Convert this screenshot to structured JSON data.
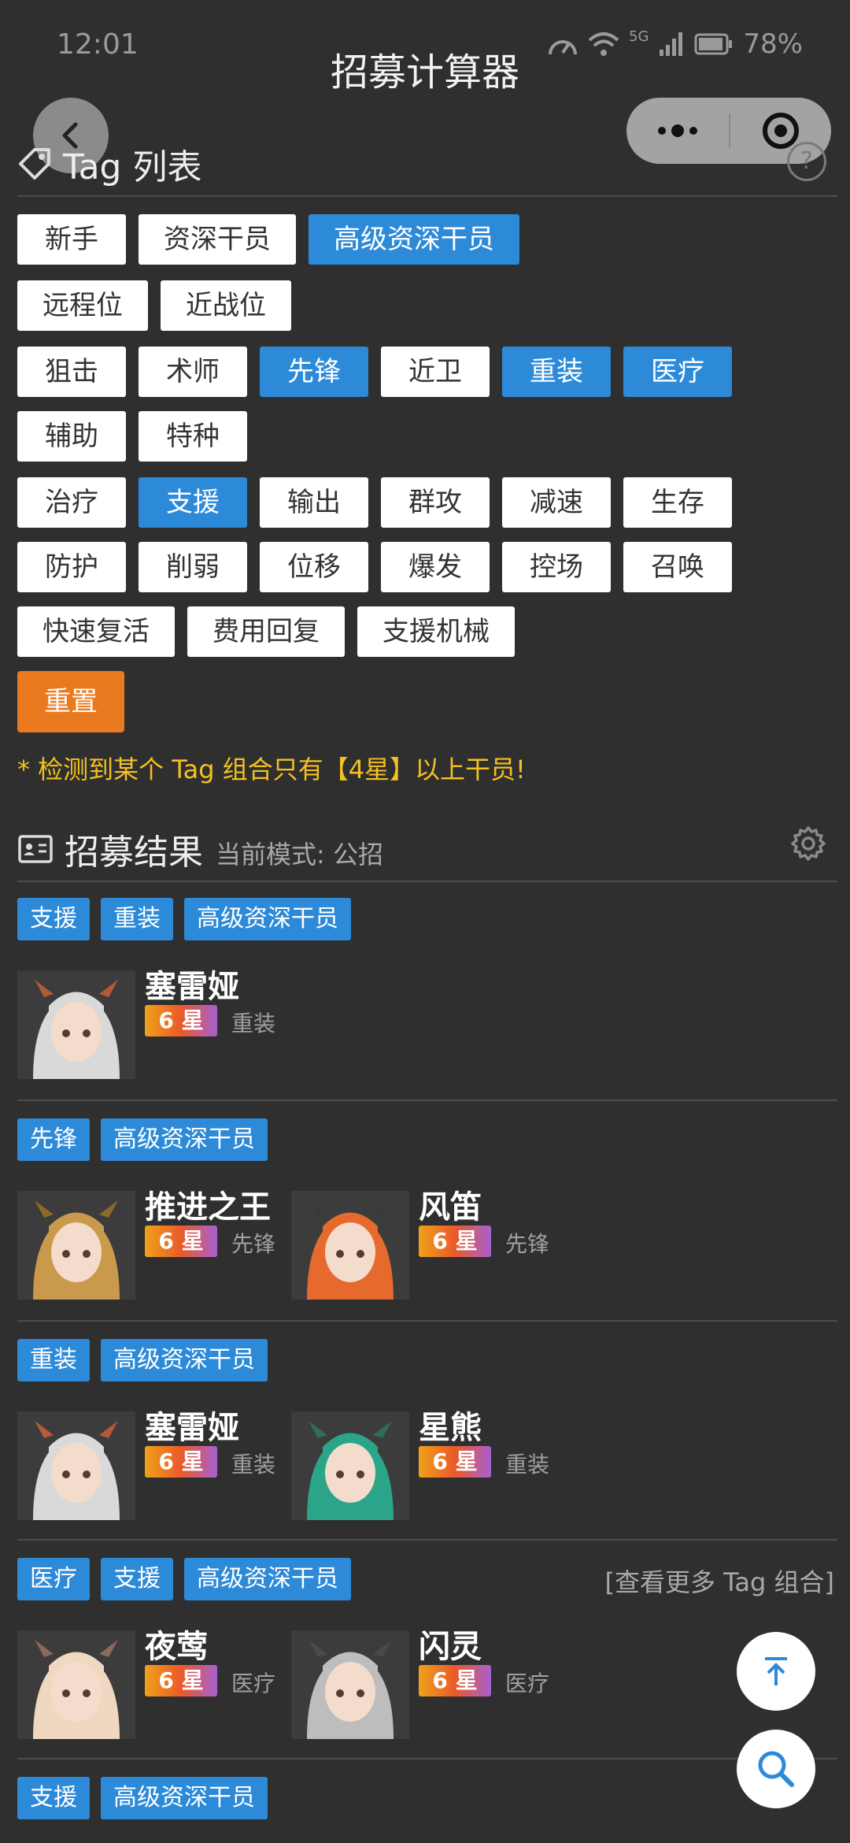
{
  "status": {
    "time": "12:01",
    "battery": "78%",
    "signal_label": "5G"
  },
  "nav": {
    "title": "招募计算器"
  },
  "tag_section": {
    "title": "Tag 列表",
    "rows": [
      [
        {
          "label": "新手",
          "selected": false,
          "w2": true
        },
        {
          "label": "资深干员",
          "selected": false
        },
        {
          "label": "高级资深干员",
          "selected": true
        }
      ],
      [
        {
          "label": "远程位",
          "selected": false
        },
        {
          "label": "近战位",
          "selected": false
        }
      ],
      [
        {
          "label": "狙击",
          "selected": false,
          "w2": true
        },
        {
          "label": "术师",
          "selected": false,
          "w2": true
        },
        {
          "label": "先锋",
          "selected": true,
          "w2": true
        },
        {
          "label": "近卫",
          "selected": false,
          "w2": true
        },
        {
          "label": "重装",
          "selected": true,
          "w2": true
        },
        {
          "label": "医疗",
          "selected": true,
          "w2": true
        }
      ],
      [
        {
          "label": "辅助",
          "selected": false,
          "w2": true
        },
        {
          "label": "特种",
          "selected": false,
          "w2": true
        }
      ],
      [
        {
          "label": "治疗",
          "selected": false,
          "w2": true
        },
        {
          "label": "支援",
          "selected": true,
          "w2": true
        },
        {
          "label": "输出",
          "selected": false,
          "w2": true
        },
        {
          "label": "群攻",
          "selected": false,
          "w2": true
        },
        {
          "label": "减速",
          "selected": false,
          "w2": true
        },
        {
          "label": "生存",
          "selected": false,
          "w2": true
        }
      ],
      [
        {
          "label": "防护",
          "selected": false,
          "w2": true
        },
        {
          "label": "削弱",
          "selected": false,
          "w2": true
        },
        {
          "label": "位移",
          "selected": false,
          "w2": true
        },
        {
          "label": "爆发",
          "selected": false,
          "w2": true
        },
        {
          "label": "控场",
          "selected": false,
          "w2": true
        },
        {
          "label": "召唤",
          "selected": false,
          "w2": true
        }
      ],
      [
        {
          "label": "快速复活",
          "selected": false
        },
        {
          "label": "费用回复",
          "selected": false
        },
        {
          "label": "支援机械",
          "selected": false
        }
      ]
    ],
    "reset_label": "重置",
    "warning": "* 检测到某个 Tag 组合只有【4星】以上干员!"
  },
  "results_section": {
    "title": "招募结果",
    "mode": "当前模式: 公招",
    "more_link": "[查看更多 Tag 组合]",
    "groups": [
      {
        "tags": [
          "支援",
          "重装",
          "高级资深干员"
        ],
        "ops": [
          {
            "name": "塞雷娅",
            "star": "6 星",
            "cls": "重装",
            "hair": "#d9d9d9",
            "horn": "#b45a3a"
          }
        ]
      },
      {
        "tags": [
          "先锋",
          "高级资深干员"
        ],
        "ops": [
          {
            "name": "推进之王",
            "star": "6 星",
            "cls": "先锋",
            "hair": "#c99a4c",
            "horn": "#8c6a2c"
          },
          {
            "name": "风笛",
            "star": "6 星",
            "cls": "先锋",
            "hair": "#e66a2e",
            "horn": "#3a3a3a"
          }
        ]
      },
      {
        "tags": [
          "重装",
          "高级资深干员"
        ],
        "ops": [
          {
            "name": "塞雷娅",
            "star": "6 星",
            "cls": "重装",
            "hair": "#d9d9d9",
            "horn": "#b45a3a"
          },
          {
            "name": "星熊",
            "star": "6 星",
            "cls": "重装",
            "hair": "#2aa58a",
            "horn": "#2f6b5e"
          }
        ]
      },
      {
        "tags": [
          "医疗",
          "支援",
          "高级资深干员"
        ],
        "ops": [
          {
            "name": "夜莺",
            "star": "6 星",
            "cls": "医疗",
            "hair": "#f0d8c0",
            "horn": "#8a6a5a"
          },
          {
            "name": "闪灵",
            "star": "6 星",
            "cls": "医疗",
            "hair": "#bdbdbd",
            "horn": "#4a4a4a"
          }
        ]
      },
      {
        "tags": [
          "支援",
          "高级资深干员"
        ],
        "ops": []
      }
    ]
  }
}
